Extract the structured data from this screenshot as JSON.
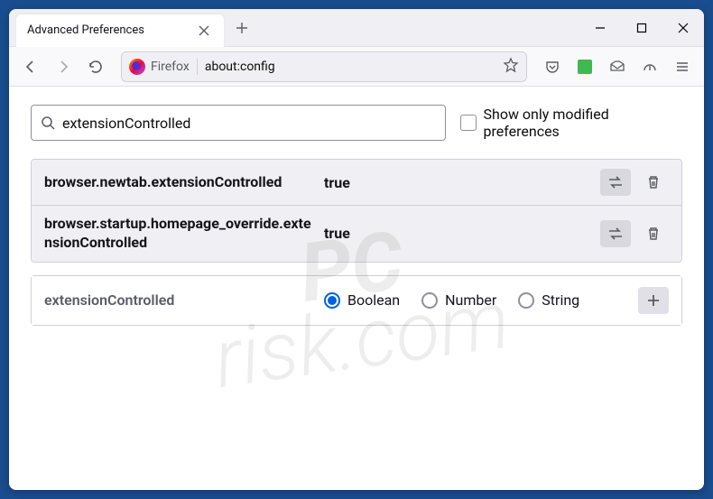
{
  "window": {
    "tab_title": "Advanced Preferences"
  },
  "toolbar": {
    "identity_label": "Firefox",
    "url": "about:config"
  },
  "search": {
    "value": "extensionControlled",
    "checkbox_label": "Show only modified preferences"
  },
  "prefs": [
    {
      "name": "browser.newtab.extensionControlled",
      "value": "true"
    },
    {
      "name": "browser.startup.homepage_override.extensionControlled",
      "value": "true"
    }
  ],
  "add_row": {
    "name": "extensionControlled",
    "types": [
      "Boolean",
      "Number",
      "String"
    ],
    "selected": "Boolean"
  },
  "watermark": {
    "l1": "PC",
    "l2": "risk.com"
  }
}
